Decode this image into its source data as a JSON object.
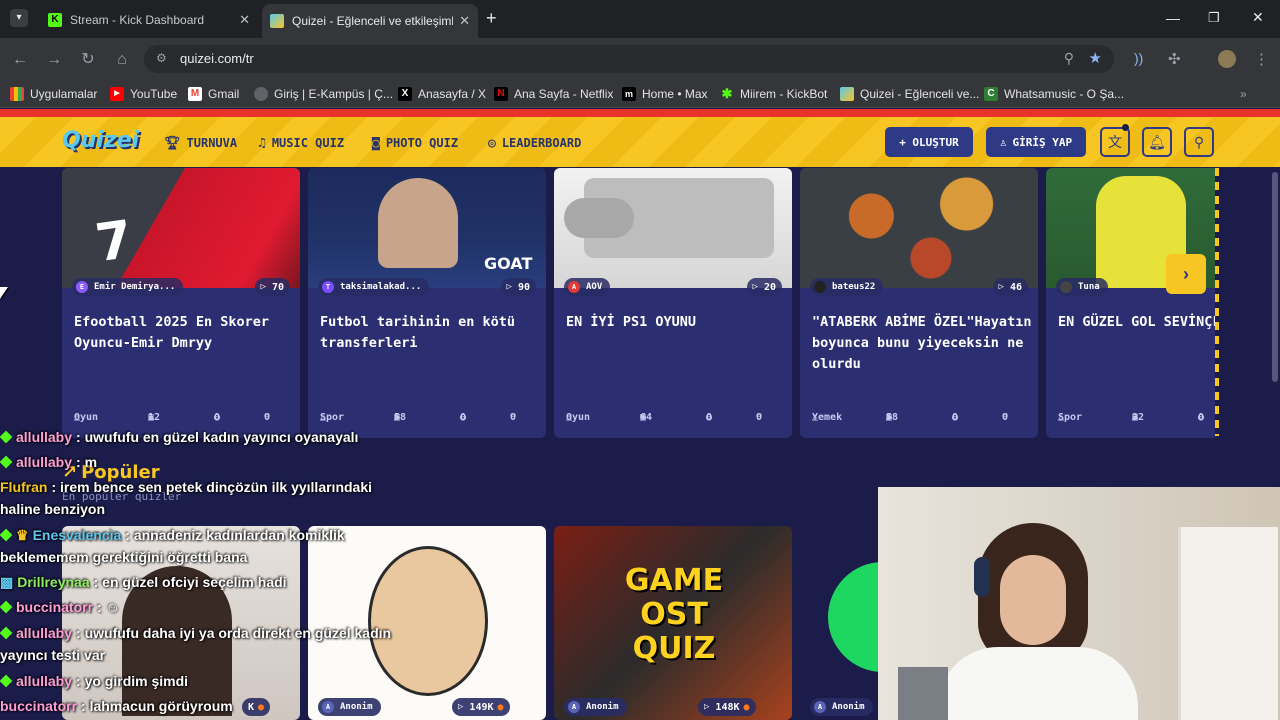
{
  "browser": {
    "tabs": [
      {
        "label": "Stream - Kick Dashboard",
        "active": false
      },
      {
        "label": "Quizei - Eğlenceli ve etkileşimli",
        "active": true
      }
    ],
    "new_tab": "+",
    "url": "quizei.com/tr",
    "bookmarks": [
      {
        "label": "Uygulamalar",
        "icon": "grid-icon"
      },
      {
        "label": "YouTube",
        "icon": "youtube-icon"
      },
      {
        "label": "Gmail",
        "icon": "gmail-icon"
      },
      {
        "label": "Giriş | E-Kampüs | Ç...",
        "icon": "globe-icon"
      },
      {
        "label": "Anasayfa / X",
        "icon": "x-icon"
      },
      {
        "label": "Ana Sayfa - Netflix",
        "icon": "netflix-icon"
      },
      {
        "label": "Home • Max",
        "icon": "max-icon"
      },
      {
        "label": "Miirem - KickBot",
        "icon": "kickbot-icon"
      },
      {
        "label": "Quizei - Eğlenceli ve...",
        "icon": "quizei-icon"
      },
      {
        "label": "Whatsamusic - O Şa...",
        "icon": "whatsamusic-icon"
      }
    ]
  },
  "site": {
    "logo": "Quizei",
    "nav": [
      {
        "label": "TURNUVA",
        "icon": "trophy-icon"
      },
      {
        "label": "MUSIC QUIZ",
        "icon": "music-note-icon"
      },
      {
        "label": "PHOTO QUIZ",
        "icon": "camera-icon"
      },
      {
        "label": "LEADERBOARD",
        "icon": "medal-icon"
      }
    ],
    "create_label": "+ OLUŞTUR",
    "login_label": "GİRİŞ YAP"
  },
  "cards": [
    {
      "author": "Emir Demirya...",
      "author_initial": "E",
      "plays": "70",
      "title": "Efootball 2025 En Skorer Oyuncu-Emir Dmryy",
      "category": "Oyun",
      "questions": "12",
      "comments": "0",
      "likes": "0"
    },
    {
      "author": "taksimalakad...",
      "author_initial": "T",
      "plays": "90",
      "title": "Futbol tarihinin en kötü transferleri",
      "category": "Spor",
      "questions": "58",
      "comments": "0",
      "likes": "0"
    },
    {
      "author": "AOV",
      "author_initial": "A",
      "plays": "20",
      "title": "EN İYİ PS1 OYUNU",
      "category": "Oyun",
      "questions": "64",
      "comments": "0",
      "likes": "0"
    },
    {
      "author": "bateus22",
      "author_initial": "",
      "plays": "46",
      "title": "\"ATABERK ABİME ÖZEL\"Hayatın boyunca bunu yiyeceksin ne olurdu",
      "category": "Yemek",
      "questions": "58",
      "comments": "0",
      "likes": "0"
    },
    {
      "author": "Tuna",
      "author_initial": "",
      "plays": "",
      "title": "EN GÜZEL GOL SEVİNÇLERİ(HTALKS",
      "category": "Spor",
      "questions": "32",
      "comments": "0",
      "likes": ""
    }
  ],
  "popular": {
    "heading": "Popüler",
    "subtitle": "En popüler quizler",
    "cards": [
      {
        "author": "",
        "plays": "K"
      },
      {
        "author": "Anonim",
        "plays": "149K"
      },
      {
        "author": "Anonim",
        "plays": "148K"
      },
      {
        "author": "Anonim",
        "plays": ""
      }
    ],
    "game_ost_text": "GAME OST QUIZ"
  },
  "chat": [
    {
      "user": "allullaby",
      "color": "#ff9ed8",
      "text": ": uwufufu en güzel kadın yayıncı oyanayalı"
    },
    {
      "user": "allullaby",
      "color": "#ff9ed8",
      "text": ": m"
    },
    {
      "user": "Flufran",
      "color": "#f5c623",
      "text": ": irem bence sen petek dinçözün ilk yyıllarındaki"
    },
    {
      "user": "",
      "color": "#ffffff",
      "text": "haline benziyon"
    },
    {
      "user": "Enesvalencia",
      "color": "#5ec6f0",
      "text": ": annadeniz kadınlardan komiklik"
    },
    {
      "user": "",
      "color": "#ffffff",
      "text": "beklememem gerektiğini öğretti bana"
    },
    {
      "user": "Drillreynaa",
      "color": "#8cf060",
      "text": ": en güzel ofciyi seçelim hadi"
    },
    {
      "user": "buccinatorr",
      "color": "#ff9ed8",
      "text": ":"
    },
    {
      "user": "allullaby",
      "color": "#ff9ed8",
      "text": ": uwufufu daha iyi ya orda direkt en güzel kadın"
    },
    {
      "user": "",
      "color": "#ffffff",
      "text": "yayıncı testi var"
    },
    {
      "user": "allullaby",
      "color": "#ff9ed8",
      "text": ": yo girdim şimdi"
    },
    {
      "user": "buccinatorr",
      "color": "#ff9ed8",
      "text": ": lahmacun görüyroum"
    }
  ]
}
